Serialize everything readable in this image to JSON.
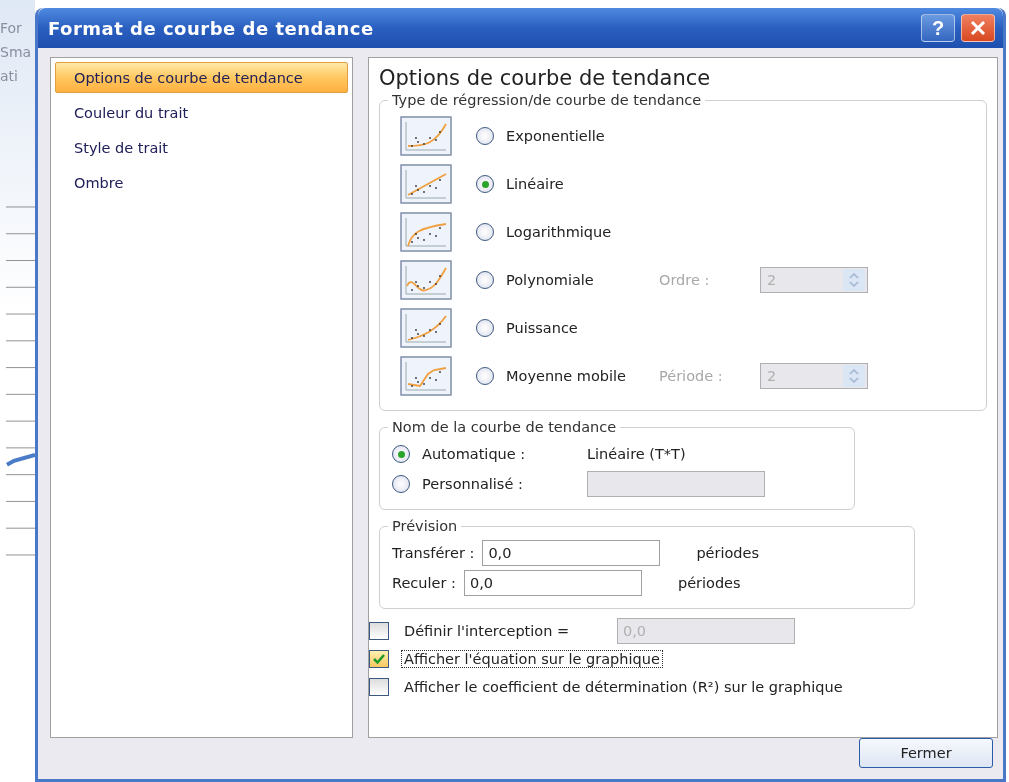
{
  "background": {
    "ribbon_texts": [
      "For",
      "Sma",
      "ati"
    ]
  },
  "window": {
    "title": "Format de courbe de tendance",
    "help": "?"
  },
  "sidebar": {
    "items": [
      {
        "label": "Options de courbe de tendance",
        "selected": true
      },
      {
        "label": "Couleur du trait",
        "selected": false
      },
      {
        "label": "Style de trait",
        "selected": false
      },
      {
        "label": "Ombre",
        "selected": false
      }
    ]
  },
  "panel": {
    "title": "Options de courbe de tendance",
    "regression": {
      "title": "Type de régression/de courbe de tendance",
      "options": [
        {
          "kind": "exponential",
          "label": "Exponentielle",
          "selected": false
        },
        {
          "kind": "linear",
          "label": "Linéaire",
          "selected": true
        },
        {
          "kind": "logarithmic",
          "label": "Logarithmique",
          "selected": false
        },
        {
          "kind": "polynomial",
          "label": "Polynomiale",
          "selected": false,
          "param_label": "Ordre :",
          "param_value": "2",
          "disabled": true
        },
        {
          "kind": "power",
          "label": "Puissance",
          "selected": false
        },
        {
          "kind": "moving_average",
          "label": "Moyenne mobile",
          "selected": false,
          "param_label": "Période :",
          "param_value": "2",
          "disabled": true
        }
      ]
    },
    "name": {
      "title": "Nom de la courbe de tendance",
      "options": [
        {
          "label": "Automatique :",
          "selected": true,
          "value": "Linéaire (T*T)"
        },
        {
          "label": "Personnalisé :",
          "selected": false,
          "field_disabled": true
        }
      ]
    },
    "forecast": {
      "title": "Prévision",
      "rows": [
        {
          "label": "Transférer :",
          "value": "0,0",
          "unit": "périodes"
        },
        {
          "label": "Reculer :",
          "value": "0,0",
          "unit": "périodes"
        }
      ]
    },
    "checkboxes": [
      {
        "label": "Définir l'interception =",
        "checked": false,
        "focused": false,
        "value": "0,0",
        "disabled": true
      },
      {
        "label": "Afficher l'équation sur le graphique",
        "checked": true,
        "focused": true
      },
      {
        "label": "Afficher le coefficient de détermination (R²) sur le graphique",
        "checked": false,
        "focused": false
      }
    ]
  },
  "buttons": [
    "Fermer"
  ]
}
